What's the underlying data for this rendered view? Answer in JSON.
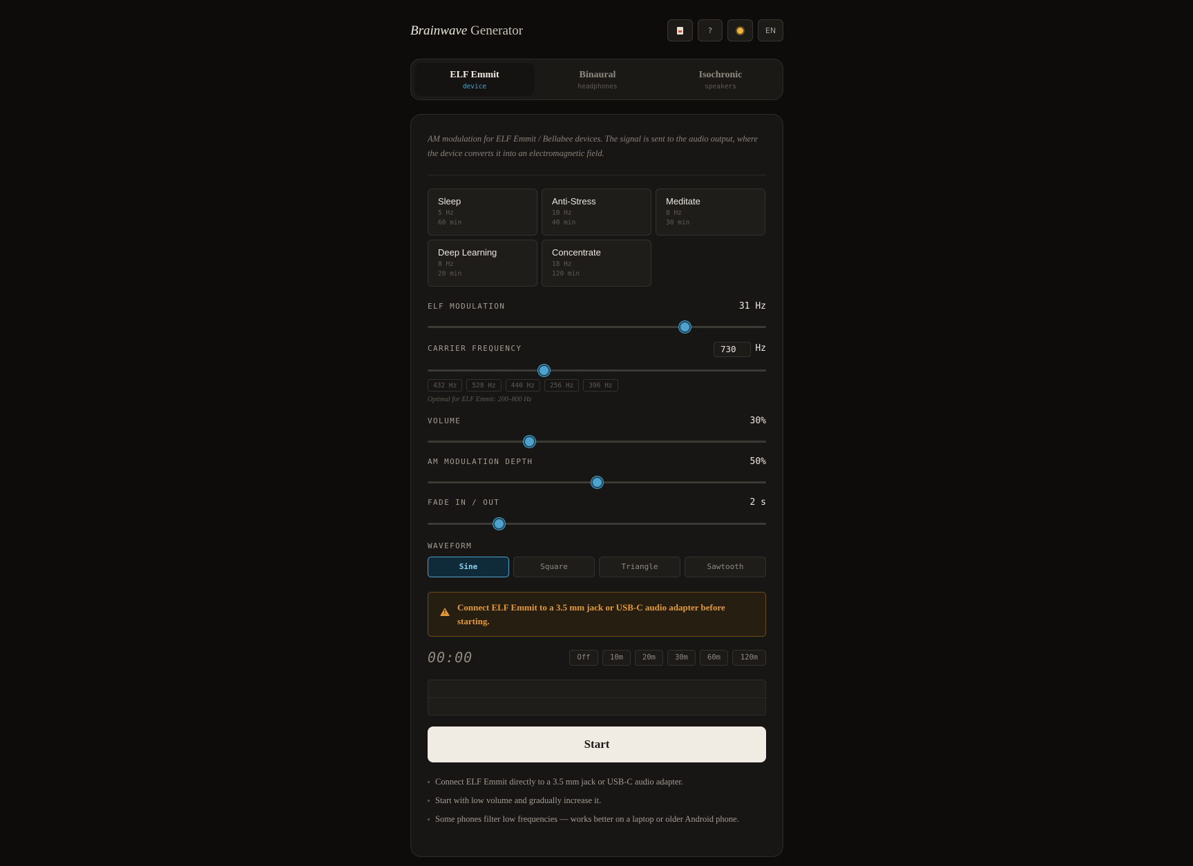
{
  "header": {
    "title_italic": "Brainwave",
    "title_rest": "Generator",
    "buttons": [
      {
        "icon": "document-icon"
      },
      {
        "label": "?"
      },
      {
        "icon": "sun-icon"
      },
      {
        "label": "EN"
      }
    ]
  },
  "tabs": [
    {
      "label": "ELF Emmit",
      "sub": "device",
      "active": true
    },
    {
      "label": "Binaural",
      "sub": "headphones",
      "active": false
    },
    {
      "label": "Isochronic",
      "sub": "speakers",
      "active": false
    }
  ],
  "description": "AM modulation for ELF Emmit / Bellabee devices. The signal is sent to the audio output, where the device converts it into an electromagnetic field.",
  "presets": [
    {
      "name": "Sleep",
      "freq": "5 Hz",
      "duration": "60 min"
    },
    {
      "name": "Anti-Stress",
      "freq": "10 Hz",
      "duration": "40 min"
    },
    {
      "name": "Meditate",
      "freq": "8 Hz",
      "duration": "30 min"
    },
    {
      "name": "Deep Learning",
      "freq": "8 Hz",
      "duration": "20 min"
    },
    {
      "name": "Concentrate",
      "freq": "18 Hz",
      "duration": "120 min"
    }
  ],
  "controls": {
    "elf": {
      "label": "ELF MODULATION",
      "value": "31",
      "unit": "Hz",
      "level": 0.76
    },
    "carrier": {
      "label": "CARRIER FREQUENCY",
      "value": "730",
      "unit": "Hz",
      "level": 0.343,
      "presets": [
        "432 Hz",
        "528 Hz",
        "440 Hz",
        "256 Hz",
        "396 Hz"
      ],
      "hint": "Optimal for ELF Emmit: 200–800 Hz"
    },
    "volume": {
      "label": "VOLUME",
      "value": "30%",
      "level": 0.3
    },
    "depth": {
      "label": "AM MODULATION DEPTH",
      "value": "50%",
      "level": 0.5
    },
    "fade": {
      "label": "FADE IN / OUT",
      "value": "2 s",
      "level": 0.21
    }
  },
  "waveform": {
    "label": "WAVEFORM",
    "options": [
      "Sine",
      "Square",
      "Triangle",
      "Sawtooth"
    ],
    "selected": "Sine"
  },
  "warning": {
    "text": "Connect ELF Emmit to a 3.5 mm jack or USB-C audio adapter before starting."
  },
  "timer": {
    "display": "00:00",
    "options": [
      "Off",
      "10m",
      "20m",
      "30m",
      "60m",
      "120m"
    ]
  },
  "start_label": "Start",
  "tips": [
    "Connect ELF Emmit directly to a 3.5 mm jack or USB-C audio adapter.",
    "Start with low volume and gradually increase it.",
    "Some phones filter low frequencies — works better on a laptop or older Android phone."
  ],
  "colors": {
    "accent": "#4ea2cc",
    "warning": "#e39b3a",
    "background": "#0d0c0a"
  }
}
